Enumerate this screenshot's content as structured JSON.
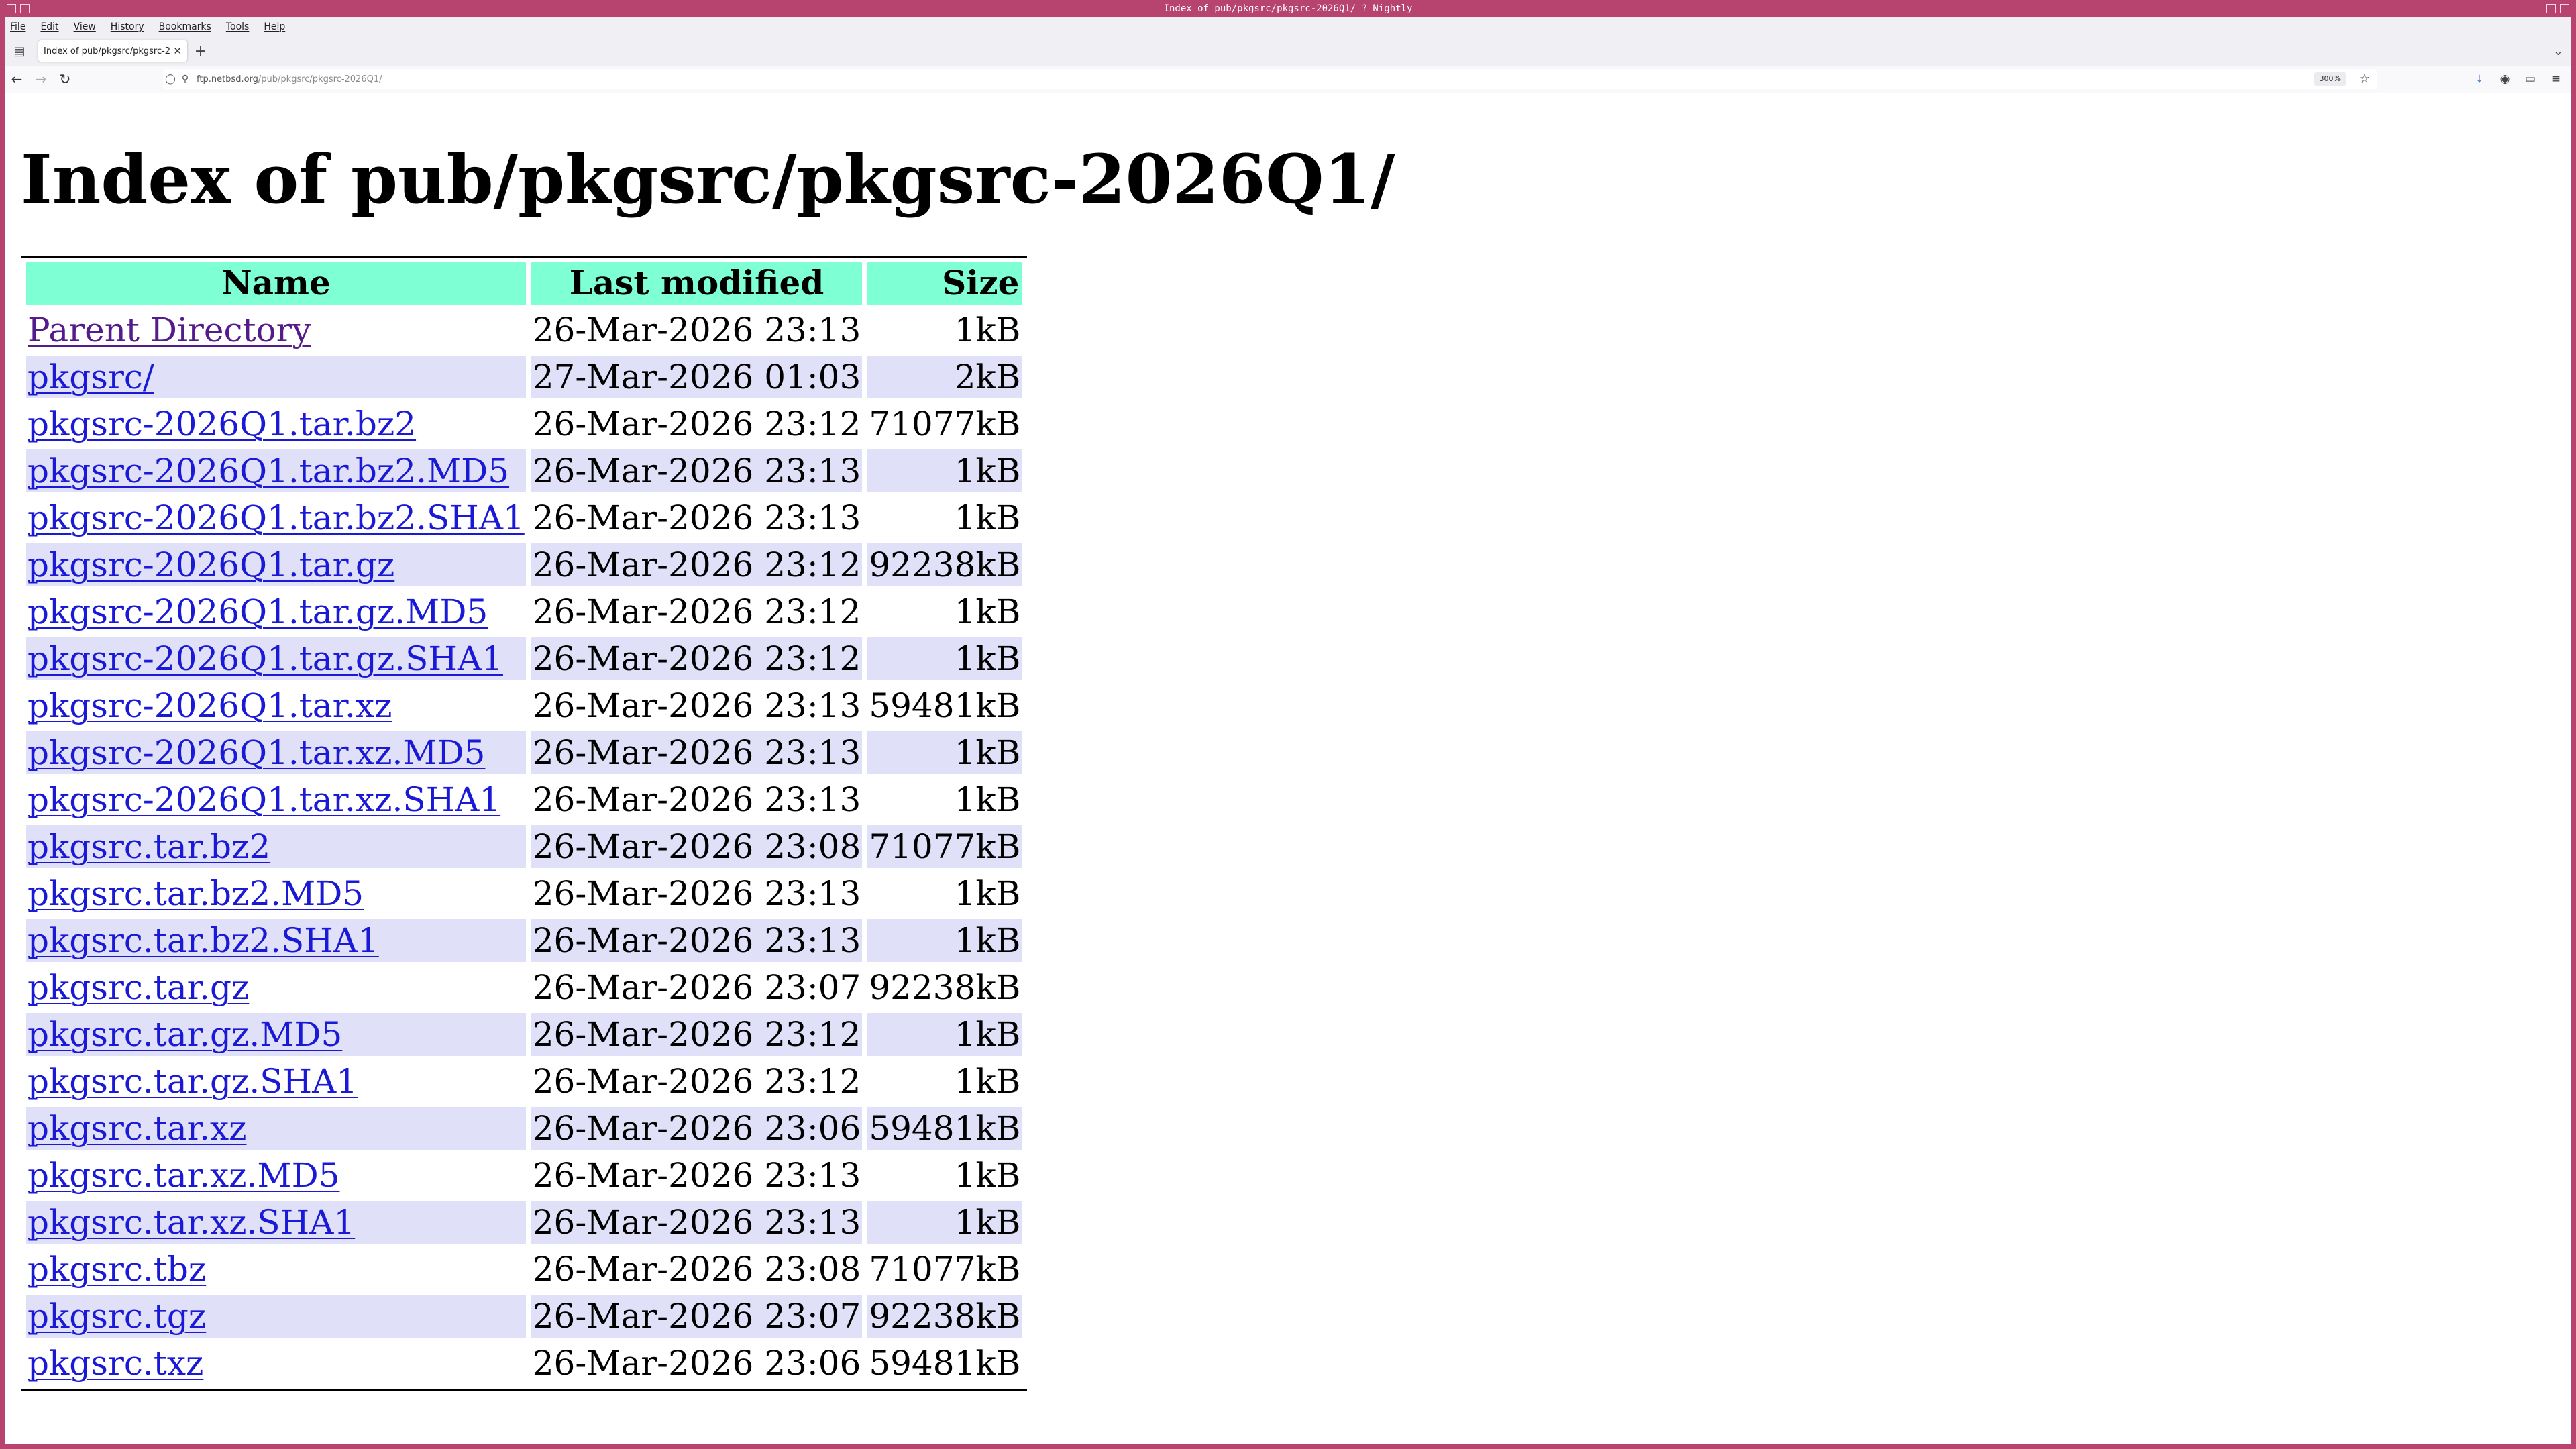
{
  "window": {
    "title": "Index of pub/pkgsrc/pkgsrc-2026Q1/ ? Nightly"
  },
  "menubar": {
    "items": [
      "File",
      "Edit",
      "View",
      "History",
      "Bookmarks",
      "Tools",
      "Help"
    ]
  },
  "tabs": [
    {
      "title": "Index of pub/pkgsrc/pkgsrc-2026Q1/",
      "active": true
    }
  ],
  "navbar": {
    "url_host": "ftp.netbsd.org",
    "url_path": "/pub/pkgsrc/pkgsrc-2026Q1/",
    "zoom": "300%"
  },
  "page": {
    "heading": "Index of pub/pkgsrc/pkgsrc-2026Q1/",
    "columns": {
      "name": "Name",
      "modified": "Last modified",
      "size": "Size"
    },
    "rows": [
      {
        "name": "Parent Directory",
        "modified": "26-Mar-2026 23:13",
        "size": "1kB"
      },
      {
        "name": "pkgsrc/",
        "modified": "27-Mar-2026 01:03",
        "size": "2kB"
      },
      {
        "name": "pkgsrc-2026Q1.tar.bz2",
        "modified": "26-Mar-2026 23:12",
        "size": "71077kB"
      },
      {
        "name": "pkgsrc-2026Q1.tar.bz2.MD5",
        "modified": "26-Mar-2026 23:13",
        "size": "1kB"
      },
      {
        "name": "pkgsrc-2026Q1.tar.bz2.SHA1",
        "modified": "26-Mar-2026 23:13",
        "size": "1kB"
      },
      {
        "name": "pkgsrc-2026Q1.tar.gz",
        "modified": "26-Mar-2026 23:12",
        "size": "92238kB"
      },
      {
        "name": "pkgsrc-2026Q1.tar.gz.MD5",
        "modified": "26-Mar-2026 23:12",
        "size": "1kB"
      },
      {
        "name": "pkgsrc-2026Q1.tar.gz.SHA1",
        "modified": "26-Mar-2026 23:12",
        "size": "1kB"
      },
      {
        "name": "pkgsrc-2026Q1.tar.xz",
        "modified": "26-Mar-2026 23:13",
        "size": "59481kB"
      },
      {
        "name": "pkgsrc-2026Q1.tar.xz.MD5",
        "modified": "26-Mar-2026 23:13",
        "size": "1kB"
      },
      {
        "name": "pkgsrc-2026Q1.tar.xz.SHA1",
        "modified": "26-Mar-2026 23:13",
        "size": "1kB"
      },
      {
        "name": "pkgsrc.tar.bz2",
        "modified": "26-Mar-2026 23:08",
        "size": "71077kB"
      },
      {
        "name": "pkgsrc.tar.bz2.MD5",
        "modified": "26-Mar-2026 23:13",
        "size": "1kB"
      },
      {
        "name": "pkgsrc.tar.bz2.SHA1",
        "modified": "26-Mar-2026 23:13",
        "size": "1kB"
      },
      {
        "name": "pkgsrc.tar.gz",
        "modified": "26-Mar-2026 23:07",
        "size": "92238kB"
      },
      {
        "name": "pkgsrc.tar.gz.MD5",
        "modified": "26-Mar-2026 23:12",
        "size": "1kB"
      },
      {
        "name": "pkgsrc.tar.gz.SHA1",
        "modified": "26-Mar-2026 23:12",
        "size": "1kB"
      },
      {
        "name": "pkgsrc.tar.xz",
        "modified": "26-Mar-2026 23:06",
        "size": "59481kB"
      },
      {
        "name": "pkgsrc.tar.xz.MD5",
        "modified": "26-Mar-2026 23:13",
        "size": "1kB"
      },
      {
        "name": "pkgsrc.tar.xz.SHA1",
        "modified": "26-Mar-2026 23:13",
        "size": "1kB"
      },
      {
        "name": "pkgsrc.tbz",
        "modified": "26-Mar-2026 23:08",
        "size": "71077kB"
      },
      {
        "name": "pkgsrc.tgz",
        "modified": "26-Mar-2026 23:07",
        "size": "92238kB"
      },
      {
        "name": "pkgsrc.txz",
        "modified": "26-Mar-2026 23:06",
        "size": "59481kB"
      }
    ]
  },
  "colors": {
    "window_border": "#b6446f",
    "header_bg": "#7fffd4",
    "alt_row_bg": "#e0e0f8",
    "link": "#1a1ad6",
    "visited_link": "#551a8b"
  },
  "icons": {
    "tab_list": "tab-list-icon",
    "back": "back-arrow-icon",
    "forward": "forward-arrow-icon",
    "reload": "reload-icon",
    "tracking_protection": "shield-icon",
    "site_security": "lock-icon",
    "bookmark": "star-icon",
    "downloads": "download-icon",
    "account": "account-icon",
    "extensions": "puzzle-icon",
    "menu": "hamburger-menu-icon"
  }
}
